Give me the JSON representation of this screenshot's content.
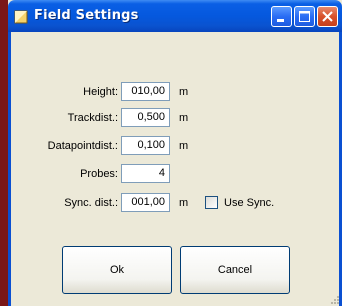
{
  "window": {
    "title": "Field Settings",
    "controls": [
      "minimize-icon",
      "maximize-icon",
      "close-icon"
    ]
  },
  "form": {
    "height_label": "Height:",
    "height_value": "010,00",
    "height_unit": "m",
    "trackdist_label": "Trackdist.:",
    "trackdist_value": "0,500",
    "trackdist_unit": "m",
    "datapointdist_label": "Datapointdist.:",
    "datapointdist_value": "0,100",
    "datapointdist_unit": "m",
    "probes_label": "Probes:",
    "probes_value": "4",
    "syncdist_label": "Sync. dist.:",
    "syncdist_value": "001,00",
    "syncdist_unit": "m",
    "use_sync_label": "Use Sync.",
    "use_sync_checked": false
  },
  "buttons": {
    "ok_label": "Ok",
    "cancel_label": "Cancel"
  },
  "colors": {
    "titlebar": "#0558de",
    "window_bg": "#ece9d8",
    "desktop_bg": "#7a1717",
    "close_button": "#d8512b"
  }
}
